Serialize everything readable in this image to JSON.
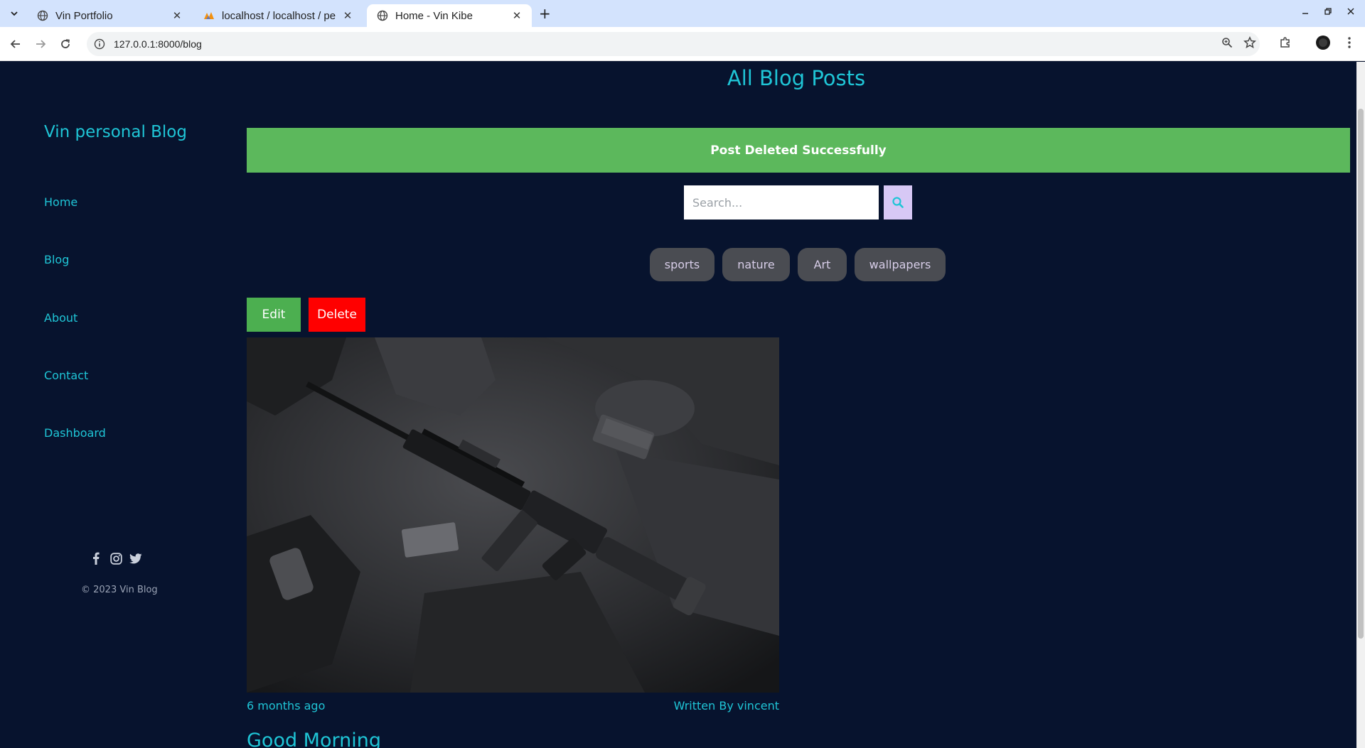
{
  "browser": {
    "tabs": [
      {
        "title": "Vin Portfolio",
        "active": false
      },
      {
        "title": "localhost / localhost / pe",
        "active": false
      },
      {
        "title": "Home - Vin Kibe",
        "active": true
      }
    ],
    "url": "127.0.0.1:8000/blog"
  },
  "sidebar": {
    "brand": "Vin personal Blog",
    "nav": [
      "Home",
      "Blog",
      "About",
      "Contact",
      "Dashboard"
    ],
    "social_icons": [
      "facebook-icon",
      "instagram-icon",
      "twitter-icon"
    ],
    "copyright": "© 2023 Vin Blog"
  },
  "main": {
    "heading": "All Blog Posts",
    "alert": "Post Deleted Successfully",
    "search": {
      "placeholder": "Search...",
      "value": ""
    },
    "tags": [
      "sports",
      "nature",
      "Art",
      "wallpapers"
    ],
    "actions": {
      "edit": "Edit",
      "delete": "Delete"
    },
    "post": {
      "time": "6 months ago",
      "author": "Written By vincent",
      "title": "Good Morning"
    }
  },
  "colors": {
    "background": "#07132e",
    "accent": "#1fc5d6",
    "alert": "#5cb85c",
    "edit": "#4caf50",
    "delete": "#ff0000",
    "tag": "#4a4c52"
  }
}
